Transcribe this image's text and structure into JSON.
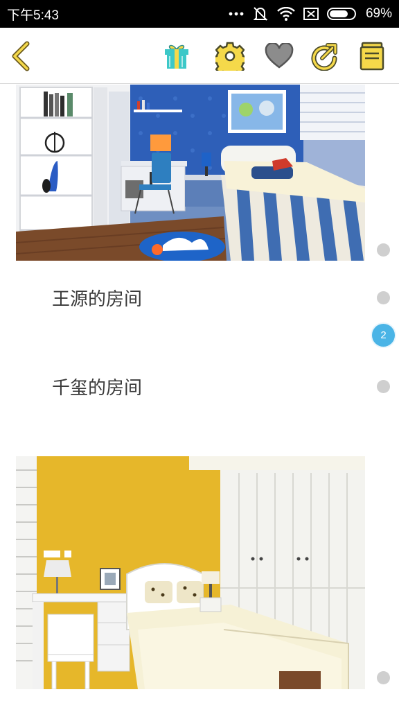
{
  "status_bar": {
    "time": "下午5:43",
    "battery": "69%",
    "icons": [
      "more-dots-icon",
      "mute-vibrate-icon",
      "wifi-icon",
      "sim-none-icon",
      "battery-icon"
    ]
  },
  "toolbar": {
    "accent_color": "#f5d94a",
    "icons": [
      "back-icon",
      "gift-icon",
      "gear-icon",
      "heart-icon",
      "share-icon",
      "note-icon"
    ]
  },
  "rooms": [
    {
      "title": "王源的房间"
    },
    {
      "title": "千玺的房间"
    }
  ],
  "pager": {
    "current": "2",
    "badge_color": "#4ab4e6"
  }
}
